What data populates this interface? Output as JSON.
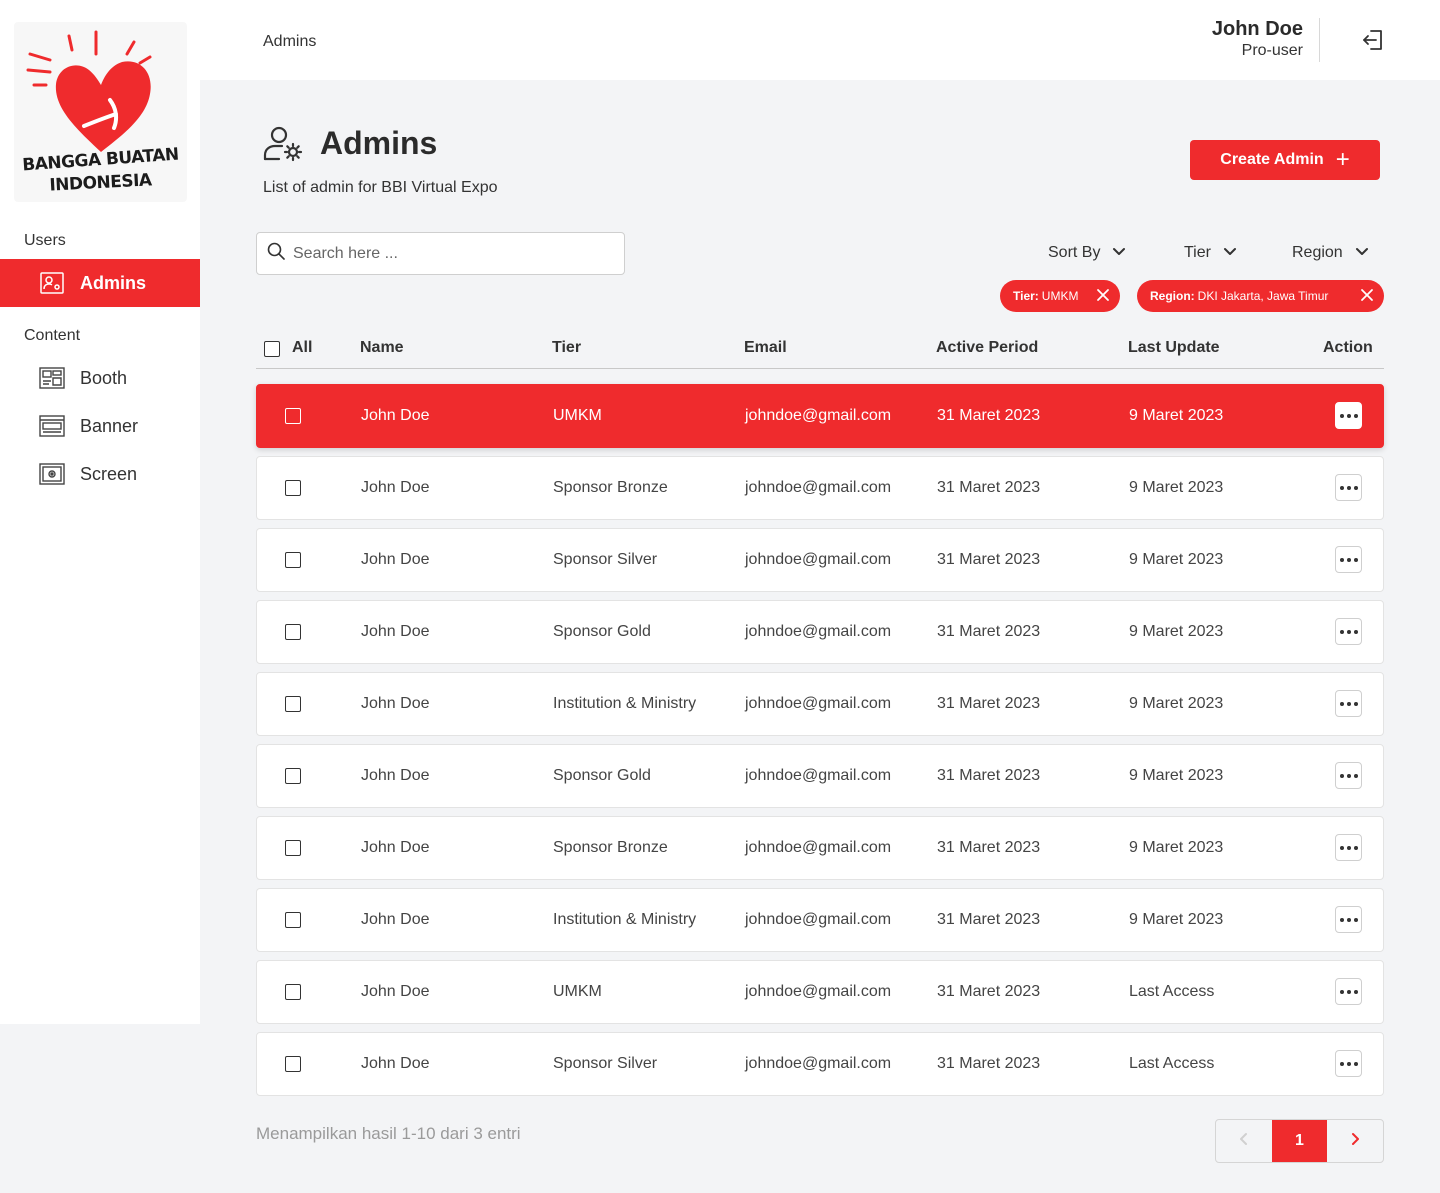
{
  "brand": {
    "logo_line1": "BANGGA BUATAN",
    "logo_line2": "INDONESIA",
    "accent": "#ef2b2d"
  },
  "sidebar": {
    "sections": [
      {
        "label": "Users",
        "items": [
          {
            "label": "Admins",
            "icon": "admin-icon",
            "active": true
          }
        ]
      },
      {
        "label": "Content",
        "items": [
          {
            "label": "Booth",
            "icon": "booth-icon"
          },
          {
            "label": "Banner",
            "icon": "banner-icon"
          },
          {
            "label": "Screen",
            "icon": "screen-icon"
          }
        ]
      }
    ]
  },
  "topbar": {
    "breadcrumb": "Admins",
    "user_name": "John Doe",
    "user_role": "Pro-user",
    "logout_icon": "logout-icon"
  },
  "header": {
    "title": "Admins",
    "subtitle": "List of admin for BBI Virtual Expo",
    "create_label": "Create Admin",
    "create_icon": "+"
  },
  "search": {
    "placeholder": "Search here ..."
  },
  "filters": {
    "sort": "Sort By",
    "tier": "Tier",
    "region": "Region"
  },
  "chips": [
    {
      "key": "Tier:",
      "value": "UMKM"
    },
    {
      "key": "Region:",
      "value": "DKI Jakarta, Jawa Timur"
    }
  ],
  "table": {
    "columns": {
      "all": "All",
      "name": "Name",
      "tier": "Tier",
      "email": "Email",
      "active": "Active Period",
      "update": "Last Update",
      "action": "Action"
    },
    "rows": [
      {
        "name": "John Doe",
        "tier": "UMKM",
        "email": "johndoe@gmail.com",
        "active": "31 Maret 2023",
        "update": "9 Maret 2023",
        "selected": true
      },
      {
        "name": "John Doe",
        "tier": "Sponsor Bronze",
        "email": "johndoe@gmail.com",
        "active": "31 Maret 2023",
        "update": "9 Maret 2023"
      },
      {
        "name": "John Doe",
        "tier": "Sponsor Silver",
        "email": "johndoe@gmail.com",
        "active": "31 Maret 2023",
        "update": "9 Maret 2023"
      },
      {
        "name": "John Doe",
        "tier": "Sponsor Gold",
        "email": "johndoe@gmail.com",
        "active": "31 Maret 2023",
        "update": "9 Maret 2023"
      },
      {
        "name": "John Doe",
        "tier": "Institution & Ministry",
        "email": "johndoe@gmail.com",
        "active": "31 Maret 2023",
        "update": "9 Maret 2023"
      },
      {
        "name": "John Doe",
        "tier": "Sponsor Gold",
        "email": "johndoe@gmail.com",
        "active": "31 Maret 2023",
        "update": "9 Maret 2023"
      },
      {
        "name": "John Doe",
        "tier": "Sponsor Bronze",
        "email": "johndoe@gmail.com",
        "active": "31 Maret 2023",
        "update": "9 Maret 2023"
      },
      {
        "name": "John Doe",
        "tier": "Institution & Ministry",
        "email": "johndoe@gmail.com",
        "active": "31 Maret 2023",
        "update": "9 Maret 2023"
      },
      {
        "name": "John Doe",
        "tier": "UMKM",
        "email": "johndoe@gmail.com",
        "active": "31 Maret 2023",
        "update": "Last Access"
      },
      {
        "name": "John Doe",
        "tier": "Sponsor Silver",
        "email": "johndoe@gmail.com",
        "active": "31 Maret 2023",
        "update": "Last Access"
      }
    ]
  },
  "footer": {
    "summary": "Menampilkan hasil 1-10 dari 3 entri",
    "current_page": "1"
  }
}
